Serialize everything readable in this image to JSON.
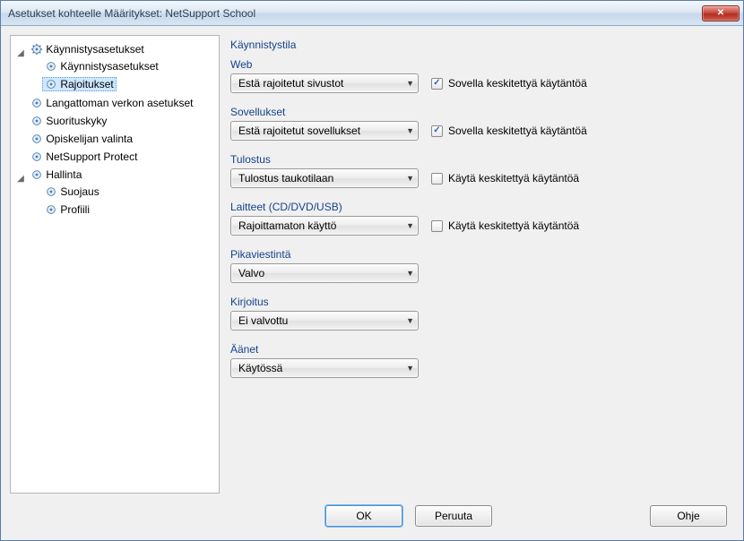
{
  "window": {
    "title": "Asetukset kohteelle Määritykset: NetSupport School"
  },
  "tree": {
    "n0": {
      "label": "Käynnistysasetukset"
    },
    "n0_0": {
      "label": "Käynnistysasetukset"
    },
    "n0_1": {
      "label": "Rajoitukset"
    },
    "n1": {
      "label": "Langattoman verkon asetukset"
    },
    "n2": {
      "label": "Suorituskyky"
    },
    "n3": {
      "label": "Opiskelijan valinta"
    },
    "n4": {
      "label": "NetSupport Protect"
    },
    "n5": {
      "label": "Hallinta"
    },
    "n5_0": {
      "label": "Suojaus"
    },
    "n5_1": {
      "label": "Profiili"
    }
  },
  "panel": {
    "heading": "Käynnistystila",
    "web": {
      "label": "Web",
      "value": "Estä rajoitetut sivustot",
      "policy": "Sovella keskitettyä käytäntöä",
      "policy_checked": true
    },
    "apps": {
      "label": "Sovellukset",
      "value": "Estä rajoitetut sovellukset",
      "policy": "Sovella keskitettyä käytäntöä",
      "policy_checked": true
    },
    "print": {
      "label": "Tulostus",
      "value": "Tulostus taukotilaan",
      "policy": "Käytä keskitettyä käytäntöä",
      "policy_checked": false
    },
    "devices": {
      "label": "Laitteet (CD/DVD/USB)",
      "value": "Rajoittamaton käyttö",
      "policy": "Käytä keskitettyä käytäntöä",
      "policy_checked": false
    },
    "im": {
      "label": "Pikaviestintä",
      "value": "Valvo"
    },
    "typing": {
      "label": "Kirjoitus",
      "value": "Ei valvottu"
    },
    "sounds": {
      "label": "Äänet",
      "value": "Käytössä"
    }
  },
  "buttons": {
    "ok": "OK",
    "cancel": "Peruuta",
    "help": "Ohje"
  }
}
